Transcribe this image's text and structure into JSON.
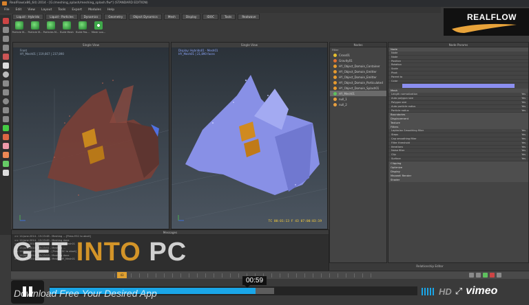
{
  "window": {
    "title": "RealFlow(x86_64) 2014 - [G:/meshing_splash/meshing_splash.flw*] (STANDARD EDITION)"
  },
  "menu": [
    "File",
    "Edit",
    "View",
    "Layout",
    "Tools",
    "Export",
    "Modules",
    "Help"
  ],
  "toolbar": {
    "tabs": [
      "Liquid - Hybrido",
      "Liquid - Particles",
      "Dynamics",
      "Geometry",
      "Object Dynamics",
      "Mesh",
      "Display",
      "IDOC",
      "Tools",
      "Realwave"
    ],
    "buttons": [
      "Particle M...",
      "Particle M...",
      "Particles M...",
      "Build Mesh",
      "Build Pas...",
      "Mesh Loo..."
    ]
  },
  "logo": {
    "text": "REALFLOW",
    "color": "#e8a33a"
  },
  "viewports": [
    {
      "title": "Single View",
      "info_line1": "Front",
      "info_line2": "HY_Mesh01 | 119,667 | 237,890"
    },
    {
      "title": "Single View",
      "info_line1": "Display: Hybrido01 - Mesh01",
      "info_line2": "HY_Mesh01 | 21,890 faces",
      "timecode": "TC 00:01:13   F 43   07:00:03:19"
    }
  ],
  "nodes": {
    "title": "Nodes",
    "tab": "Filter",
    "items": [
      "Cross01",
      "Gravity01",
      "HY_Object_Domain_Container",
      "HY_Object_Domain_Emitter",
      "HY_Object_Domain_Emitter",
      "HY_Object_Domain_Particulated",
      "HY_Object_Domain_Splash01",
      "HY_Mesh01",
      "null_1",
      "null_2"
    ],
    "selected_index": 7
  },
  "params": {
    "title": "Node Params",
    "tab": "Node",
    "rows_top": [
      "Node",
      "Node",
      "Position",
      "Rotation",
      "Scale",
      "Pivot",
      "Parent to",
      "Color"
    ],
    "sections": [
      {
        "name": "Mesh",
        "rows": [
          "Length normalization",
          "Auto polygon size",
          "Polygon size",
          "Auto particle radius",
          "Particle radius"
        ]
      },
      {
        "name": "Boundaries",
        "rows": []
      },
      {
        "name": "Displacement",
        "rows": []
      },
      {
        "name": "Texture",
        "rows": []
      },
      {
        "name": "Filters",
        "rows": [
          "Laplacian Smoothing filter",
          "Steps",
          "Cap smoothing filter",
          "Filter threshold",
          "Iterations",
          "Noise filter",
          "Clip",
          "Surface"
        ]
      },
      {
        "name": "Clipping",
        "rows": []
      },
      {
        "name": "Optimize",
        "rows": []
      },
      {
        "name": "Display",
        "rows": []
      },
      {
        "name": "Maxwell Render",
        "rows": []
      },
      {
        "name": "Shader",
        "rows": []
      }
    ],
    "value_yes": "Yes"
  },
  "messages": {
    "title": "Messages",
    "lines": [
      ">> 14.June.2014 - 15:23:48 - Meshing ... [Press ESC to abort]",
      ">> 14.June.2014 - 15:23:49 - Meshing done",
      ">> 14.June.2014 - 15:23:49 - Mesh - HY_Mesh01",
      ">> 14.June.2014 - 15:23:51 - Meshing ...",
      ">> 14.June.2014 - 15:23:52 - [Press ESC to abort]",
      ">> 14.June.2014 - 15:23:53 - Meshing done",
      ">> 14.June.2014 - 15:23:54 - Mesh - HY_Mesh01"
    ]
  },
  "relationship_editor": {
    "title": "Relationship Editor"
  },
  "timeline": {
    "frame": "43"
  },
  "watermark": {
    "word1": "GET",
    "word2": "INTO",
    "word3": "PC"
  },
  "player": {
    "caption": "Download Free Your Desired App",
    "time": "00:59",
    "progress": 0.56,
    "buffered": 0.61,
    "hd": "HD",
    "brand": "vimeo"
  }
}
